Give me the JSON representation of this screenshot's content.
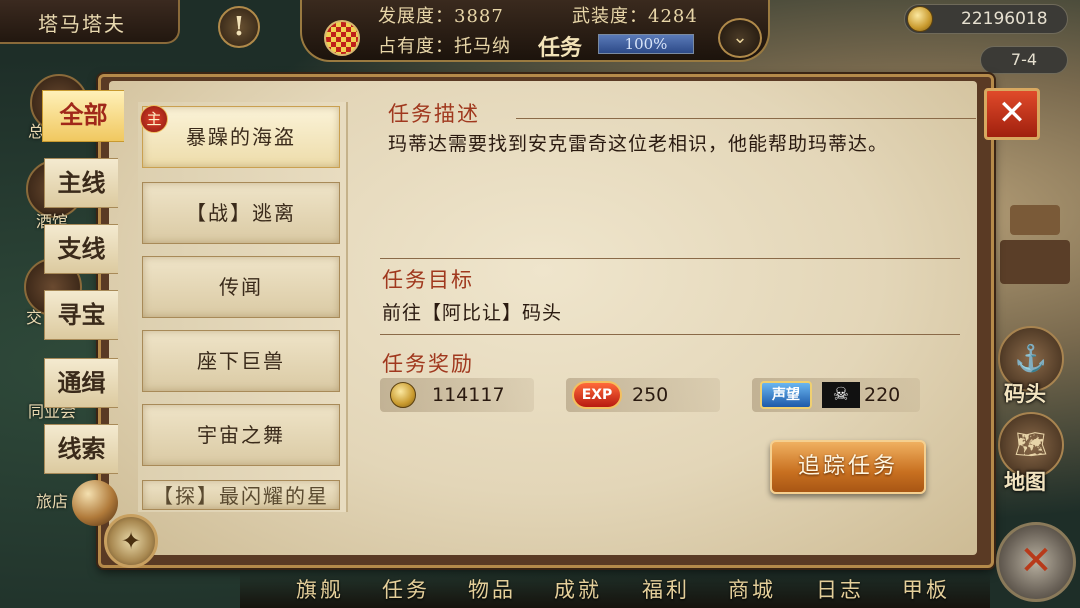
{
  "top": {
    "city_name": "塔马塔夫",
    "alert_glyph": "!",
    "development": "发展度：3887",
    "armament": "武装度：4284",
    "occupancy": "占有度：托马纳",
    "task_label": "任务",
    "progress_text": "100%",
    "progress_value": 1.0,
    "chevron_glyph": "⌄",
    "gold": "22196018",
    "date": "7-4"
  },
  "background_menu": [
    "总",
    "酒馆",
    "交",
    "同业会",
    "旅店"
  ],
  "tabs": [
    {
      "label": "全部",
      "active": true
    },
    {
      "label": "主线",
      "active": false
    },
    {
      "label": "支线",
      "active": false
    },
    {
      "label": "寻宝",
      "active": false
    },
    {
      "label": "通缉",
      "active": false
    },
    {
      "label": "线索",
      "active": false
    }
  ],
  "quests": [
    {
      "label": "暴躁的海盗",
      "badge": "主",
      "active": true
    },
    {
      "label": "【战】逃离",
      "active": false
    },
    {
      "label": "传闻",
      "active": false
    },
    {
      "label": "座下巨兽",
      "active": false
    },
    {
      "label": "宇宙之舞",
      "active": false
    },
    {
      "label": "【探】最闪耀的星",
      "active": false
    }
  ],
  "detail": {
    "description_title": "任务描述",
    "description": "玛蒂达需要找到安克雷奇这位老相识，他能帮助玛蒂达。",
    "objective_title": "任务目标",
    "objective": "前往【阿比让】码头",
    "reward_title": "任务奖励",
    "rewards": {
      "gold": "114117",
      "exp_icon": "EXP",
      "exp": "250",
      "fame_icon": "声望",
      "pirate_icon": "☠",
      "fame": "220"
    },
    "track_button": "追踪任务",
    "close_glyph": "✕"
  },
  "side": {
    "dock_label": "码头",
    "map_label": "地图",
    "dock_icon": "⚓",
    "map_icon": "🗺"
  },
  "compass_glyph": "✦",
  "bottom_nav": [
    "旗舰",
    "任务",
    "物品",
    "成就",
    "福利",
    "商城",
    "日志",
    "甲板"
  ],
  "x_glyph": "✕",
  "colors": {
    "accent_red": "#a0381e",
    "tab_active": "#f0c860",
    "button_orange": "#c87020"
  }
}
